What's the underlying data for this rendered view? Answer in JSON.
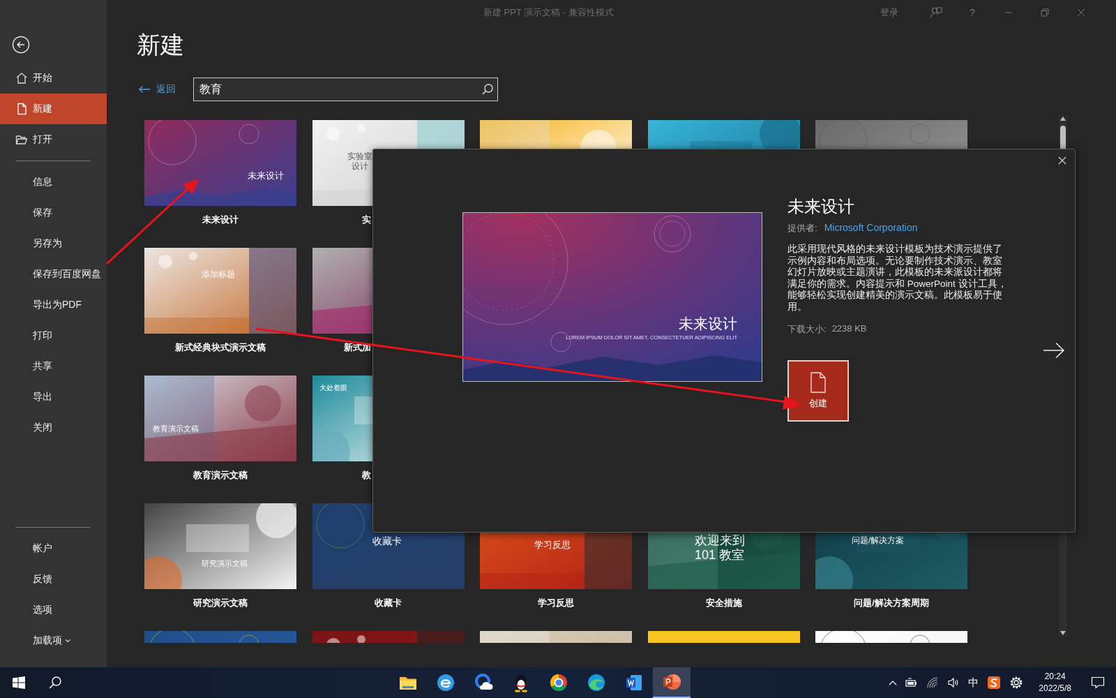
{
  "window": {
    "title": "新建 PPT 演示文稿  -  兼容性模式",
    "sign_in": "登录",
    "help": "?"
  },
  "sidebar": {
    "groups": [
      [
        {
          "label": "开始",
          "selected": false,
          "dropdown": false
        },
        {
          "label": "新建",
          "selected": true,
          "dropdown": false
        },
        {
          "label": "打开",
          "selected": false,
          "dropdown": false
        }
      ],
      [
        {
          "label": "信息",
          "selected": false,
          "dropdown": false
        },
        {
          "label": "保存",
          "selected": false,
          "dropdown": false
        },
        {
          "label": "另存为",
          "selected": false,
          "dropdown": false
        },
        {
          "label": "保存到百度网盘",
          "selected": false,
          "dropdown": false
        },
        {
          "label": "导出为PDF",
          "selected": false,
          "dropdown": false
        },
        {
          "label": "打印",
          "selected": false,
          "dropdown": false
        },
        {
          "label": "共享",
          "selected": false,
          "dropdown": false
        },
        {
          "label": "导出",
          "selected": false,
          "dropdown": false
        },
        {
          "label": "关闭",
          "selected": false,
          "dropdown": false
        }
      ],
      [
        {
          "label": "帐户",
          "selected": false,
          "dropdown": false
        },
        {
          "label": "反馈",
          "selected": false,
          "dropdown": false
        },
        {
          "label": "选项",
          "selected": false,
          "dropdown": false
        },
        {
          "label": "加载项",
          "selected": false,
          "dropdown": true
        }
      ]
    ]
  },
  "page": {
    "title": "新建",
    "back": "返回",
    "search": {
      "value": "教育"
    }
  },
  "template_rows": [
    [
      {
        "kind": "picture",
        "name": "未来设计",
        "slide_title": "未来设计",
        "partly_covered": false
      },
      {
        "kind": "picture",
        "name": "实",
        "slide_title": "实验室设计",
        "partly_covered": true
      },
      {
        "kind": "picture"
      },
      {
        "kind": "picture"
      },
      {
        "kind": "picture"
      }
    ],
    [
      {
        "kind": "picture",
        "name": "新式经典块式演示文稿",
        "slide_title": "添加标题",
        "partly_covered": false
      },
      {
        "kind": "picture",
        "name": "新式加",
        "partly_covered": true
      }
    ],
    [
      {
        "kind": "picture",
        "name": "教育演示文稿",
        "slide_title": "教育演示文稿",
        "partly_covered": false
      },
      {
        "kind": "picture",
        "name": "教",
        "slide_title": "大处着眼",
        "partly_covered": true
      }
    ],
    [
      {
        "kind": "picture",
        "name": "研究演示文稿",
        "slide_title": "研究演示文稿",
        "partly_covered": false
      },
      {
        "kind": "picture",
        "name": "收藏卡",
        "slide_title": "收藏卡",
        "partly_covered": false
      },
      {
        "kind": "picture",
        "name": "学习反思",
        "slide_title": "学习反思",
        "partly_covered": false
      },
      {
        "kind": "picture",
        "name": "安全措施",
        "slide_title": "欢迎来到 101 教室",
        "partly_covered": false
      },
      {
        "kind": "picture",
        "name": "问题/解决方案周期",
        "slide_title": "问题/解决方案",
        "partly_covered": false
      }
    ],
    [
      {
        "kind": "picture"
      },
      {
        "kind": "picture"
      },
      {
        "kind": "picture"
      },
      {
        "kind": "picture"
      },
      {
        "kind": "picture"
      }
    ]
  ],
  "dialog": {
    "title": "未来设计",
    "provider_label": "提供者:",
    "provider": "Microsoft Corporation",
    "description": "此采用现代风格的未来设计模板为技术演示提供了示例内容和布局选项。无论要制作技术演示、教室幻灯片放映或主题演讲，此模板的未来派设计都将满足你的需求。内容提示和 PowerPoint 设计工具，能够轻松实现创建精美的演示文稿。此模板易于使用。",
    "size_label": "下载大小:",
    "size": "2238 KB",
    "create": "创建",
    "preview": {
      "title": "未来设计",
      "subtitle": "LOREM IPSUM DOLOR SIT AMET, CONSECTETUER ADIPISCING ELIT"
    }
  },
  "taskbar": {
    "apps": [
      {
        "selected": false
      },
      {
        "selected": false
      },
      {
        "selected": false
      },
      {
        "selected": false
      },
      {
        "selected": false
      },
      {
        "selected": false
      },
      {
        "selected": false
      },
      {
        "selected": true
      }
    ],
    "ime": "中",
    "time": "20:24",
    "date": "2022/5/8"
  }
}
